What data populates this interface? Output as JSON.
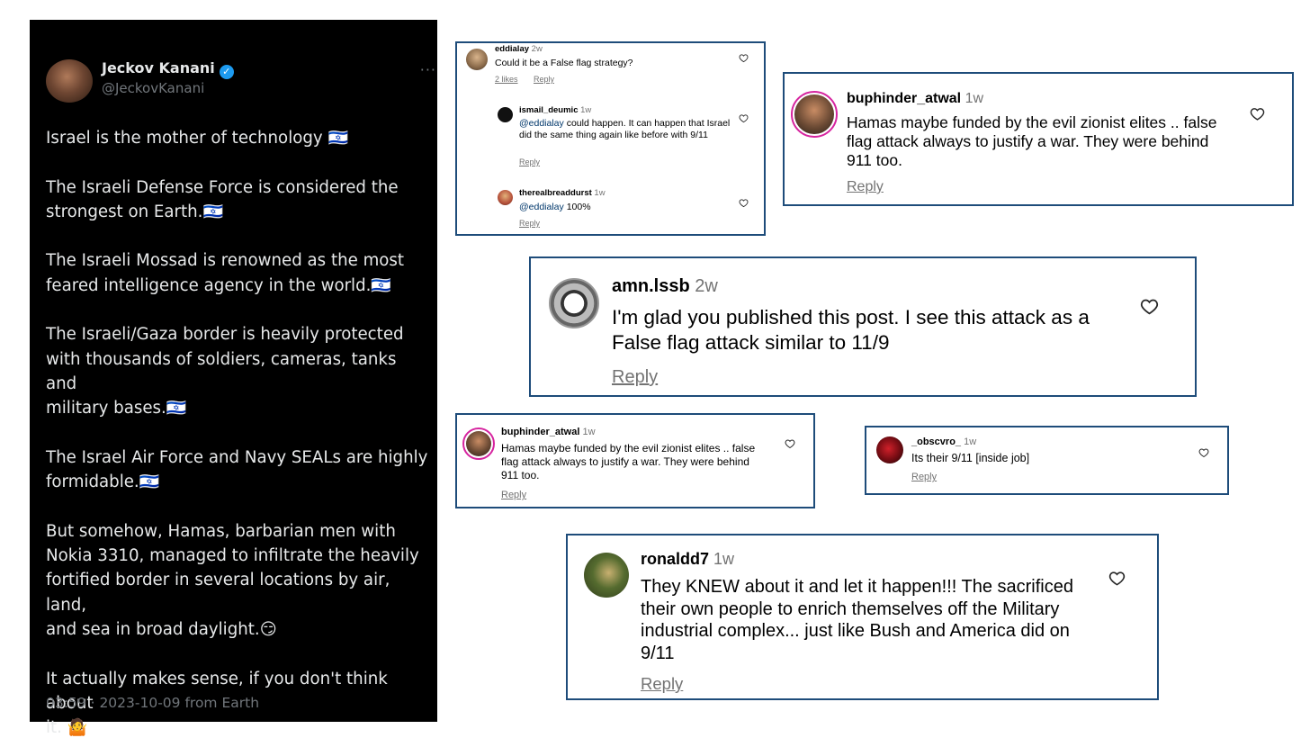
{
  "tweet": {
    "name": "Jeckov Kanani",
    "verified_mark": "✓",
    "handle": "@JeckovKanani",
    "more": "···",
    "paragraphs": [
      "Israel is the mother of technology 🇮🇱",
      "The Israeli Defense Force is considered the\nstrongest on Earth.🇮🇱",
      "The Israeli Mossad is renowned as the most\nfeared intelligence agency in the world.🇮🇱",
      "The Israeli/Gaza border is heavily protected\nwith thousands of soldiers, cameras, tanks and\nmilitary bases.🇮🇱",
      "The Israel Air Force and Navy SEALs are highly\nformidable.🇮🇱",
      "But somehow, Hamas, barbarian men with\nNokia 3310, managed to infiltrate the heavily\nfortified border in several locations by air, land,\nand sea in broad daylight.😏",
      "It actually makes sense, if you don't think about\nit. 🤷"
    ],
    "timestamp": "03:59 · 2023-10-09 from Earth"
  },
  "card1": {
    "main": {
      "user": "eddialay",
      "age": "2w",
      "text": "Could it be a False flag strategy?",
      "likes": "2 likes",
      "reply": "Reply"
    },
    "reply1": {
      "user": "ismail_deumic",
      "age": "1w",
      "mention": "@eddialay",
      "text": " could happen. It can happen that Israel did the same thing again like before with 9/11",
      "reply": "Reply"
    },
    "reply2": {
      "user": "therealbreaddurst",
      "age": "1w",
      "mention": "@eddialay",
      "text": " 100%",
      "reply": "Reply"
    }
  },
  "card2": {
    "user": "buphinder_atwal",
    "age": "1w",
    "text": "Hamas maybe funded by the evil zionist elites .. false flag attack always to justify a war. They were behind 911 too.",
    "reply": "Reply"
  },
  "card3": {
    "user": "amn.lssb",
    "age": "2w",
    "text": "I'm glad you published this post. I see this attack as a False flag attack similar to 11/9",
    "reply": "Reply"
  },
  "card4": {
    "user": "buphinder_atwal",
    "age": "1w",
    "text": "Hamas maybe funded by the evil zionist elites .. false flag attack always to justify a war. They were behind 911 too.",
    "reply": "Reply"
  },
  "card5": {
    "user": "_obscvro_",
    "age": "1w",
    "text": "Its their 9/11 [inside job]",
    "reply": "Reply"
  },
  "card6": {
    "user": "ronaldd7",
    "age": "1w",
    "text": "They KNEW about it and let it happen!!! The sacrificed their own people to enrich themselves off the Military industrial complex... just like Bush and America did on 9/11",
    "reply": "Reply"
  },
  "icons": {
    "heart": "heart-icon",
    "verified": "verified-badge-icon",
    "more": "more-icon"
  }
}
